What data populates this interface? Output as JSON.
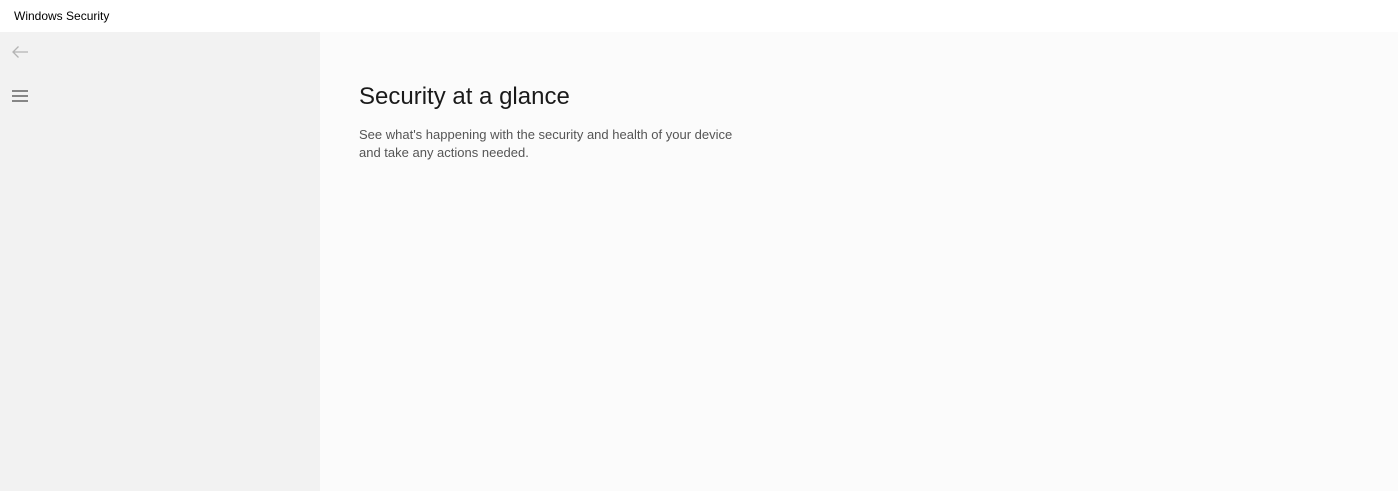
{
  "window": {
    "title": "Windows Security"
  },
  "sidebar": {
    "back_icon": "back-arrow-icon",
    "menu_icon": "hamburger-menu-icon"
  },
  "main": {
    "heading": "Security at a glance",
    "description": "See what's happening with the security and health of your device and take any actions needed."
  },
  "colors": {
    "titlebar_bg": "#ffffff",
    "sidebar_bg": "#f2f2f2",
    "main_bg": "#fbfbfb"
  }
}
